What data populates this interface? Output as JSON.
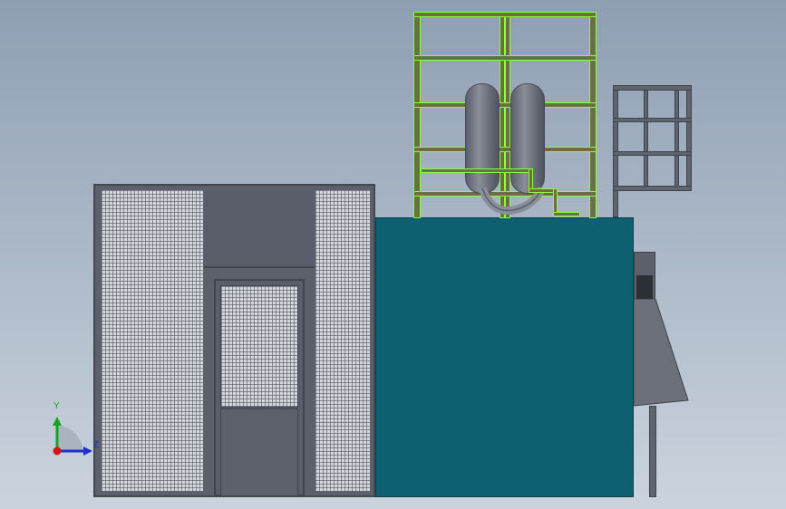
{
  "view": {
    "triad": {
      "y_label": "Y",
      "z_label": "Z",
      "colors": {
        "y": "#1aa024",
        "z": "#2030c8",
        "origin": "#d01818"
      }
    }
  },
  "colors": {
    "background_top": "#8e9fb3",
    "background_bottom": "#cbd4de",
    "booth_frame": "#5c606b",
    "mesh": "#d3d7dc",
    "tank_body": "#0e5f70",
    "steel_selected": "#8cff3a"
  }
}
